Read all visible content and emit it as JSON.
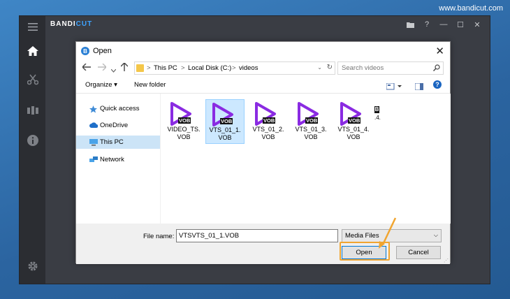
{
  "watermark": "www.bandicut.com",
  "app": {
    "logo_main": "BANDI",
    "logo_accent": "CUT",
    "sidebar": [
      {
        "icon": "menu-icon"
      },
      {
        "icon": "home-icon"
      },
      {
        "icon": "cut-icon"
      },
      {
        "icon": "join-icon"
      },
      {
        "icon": "info-icon"
      },
      {
        "icon": "settings-icon"
      }
    ],
    "titlebar_icons": [
      "folder-icon",
      "help-icon",
      "minimize-icon",
      "maximize-icon",
      "close-icon"
    ],
    "titlebar_glyphs": {
      "folder": "▬",
      "help": "?",
      "minimize": "—",
      "maximize": "☐",
      "close": "✕"
    }
  },
  "dialog": {
    "title": "Open",
    "close": "✕",
    "address": {
      "sep": ">",
      "crumbs": [
        "This PC",
        "Local Disk (C:)",
        "videos"
      ]
    },
    "search_placeholder": "Search videos",
    "toolbar": {
      "organize": "Organize ▾",
      "new_folder": "New folder"
    },
    "nav": [
      {
        "label": "Quick access",
        "icon": "star-icon",
        "selected": false
      },
      {
        "label": "OneDrive",
        "icon": "cloud-icon",
        "selected": false
      },
      {
        "label": "This PC",
        "icon": "computer-icon",
        "selected": true
      },
      {
        "label": "Network",
        "icon": "network-icon",
        "selected": false
      }
    ],
    "files": [
      {
        "name_line1": "VIDEO_TS.",
        "name_line2": "VOB",
        "badge": "VOB",
        "selected": false
      },
      {
        "name_line1": "VTS_01_1.",
        "name_line2": "VOB",
        "badge": "VOB",
        "selected": true
      },
      {
        "name_line1": "VTS_01_2.",
        "name_line2": "VOB",
        "badge": "VOB",
        "selected": false
      },
      {
        "name_line1": "VTS_01_3.",
        "name_line2": "VOB",
        "badge": "VOB",
        "selected": false
      },
      {
        "name_line1": "VTS_01_4.",
        "name_line2": "VOB",
        "badge": "VOB",
        "selected": false
      }
    ],
    "extra_item": {
      "badge": "B",
      "text": ".4."
    },
    "filename_label": "File name:",
    "filename_value": "VTSVTS_01_1.VOB",
    "filter_value": "Media Files",
    "open_button": "Open",
    "cancel_button": "Cancel"
  },
  "colors": {
    "accent": "#3da3ff",
    "play_icon": "#8a2be2",
    "highlight": "#f1a530"
  }
}
